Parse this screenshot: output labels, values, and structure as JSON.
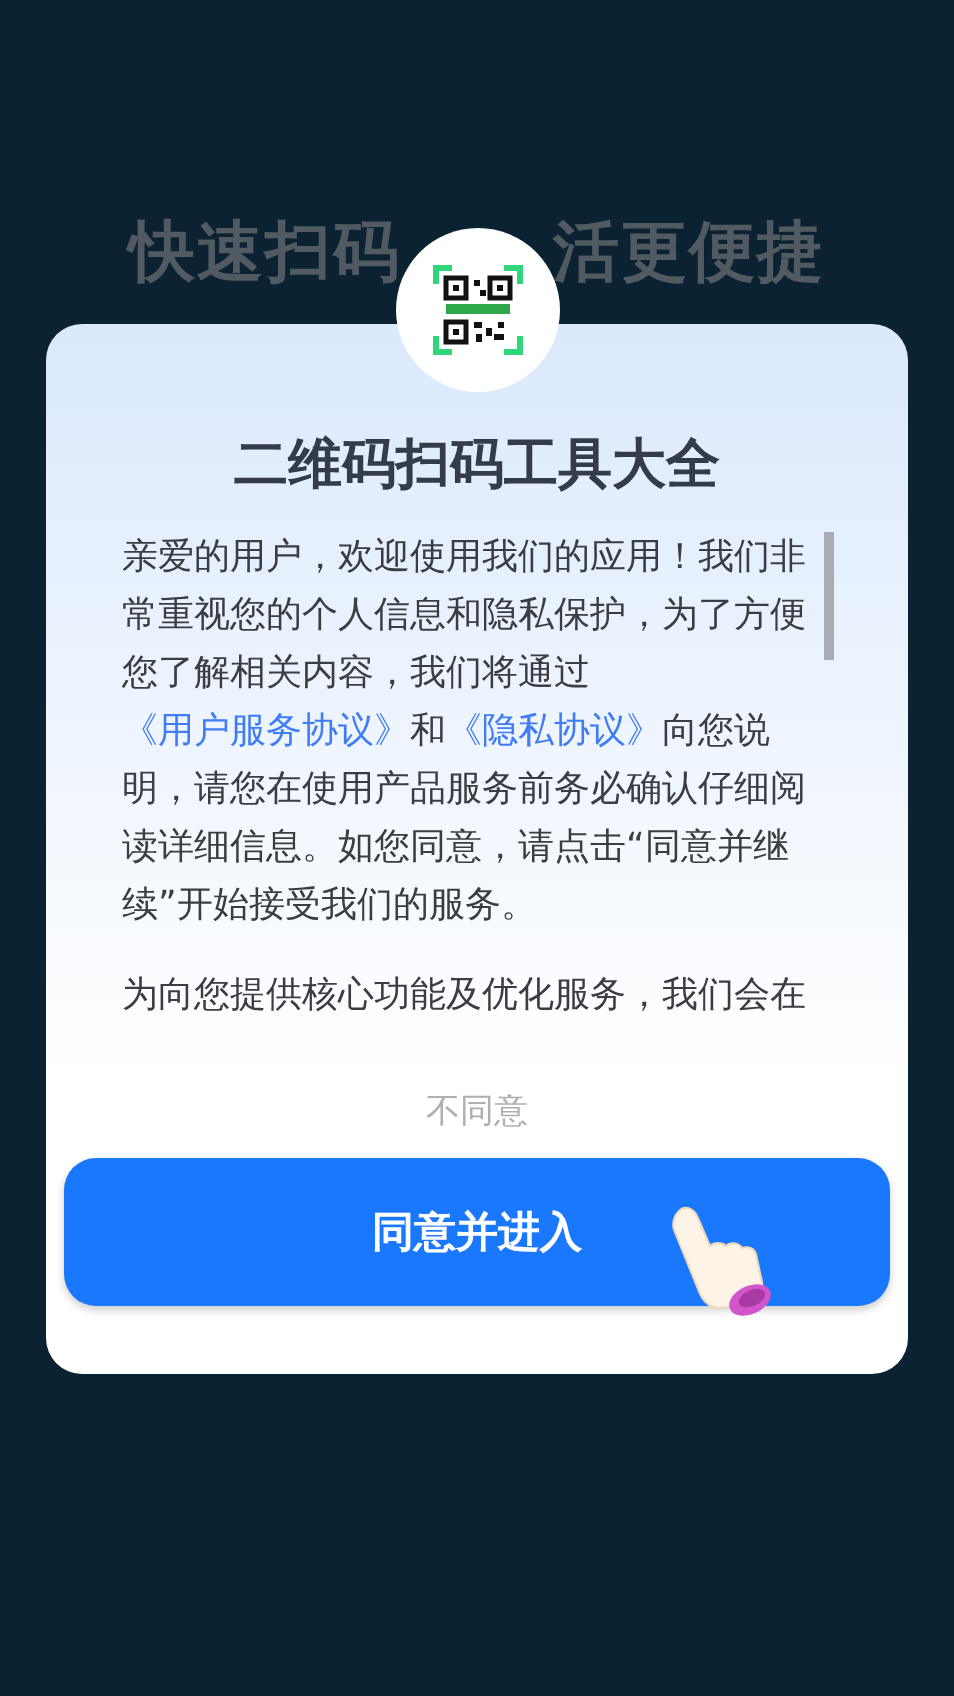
{
  "background_heading": [
    "快速扫码",
    "活更便捷"
  ],
  "dialog": {
    "title": "二维码扫码工具大全",
    "paragraphs": [
      [
        {
          "kind": "text",
          "text": "亲爱的用户，欢迎使用我们的应用！我们非常重视您的个人信息和隐私保护，为了方便您了解相关内容，我们将通过"
        },
        {
          "kind": "link",
          "text": "《用户服务协议》"
        },
        {
          "kind": "text",
          "text": "和"
        },
        {
          "kind": "link",
          "text": "《隐私协议》"
        },
        {
          "kind": "text",
          "text": "向您说明，请您在使用产品服务前务必确认仔细阅读详细信息。如您同意，请点击“同意并继续”开始接受我们的服务。"
        }
      ],
      [
        {
          "kind": "text",
          "text": "为向您提供核心功能及优化服务，我们会在"
        }
      ]
    ],
    "decline": "不同意",
    "accept": "同意并进入"
  }
}
